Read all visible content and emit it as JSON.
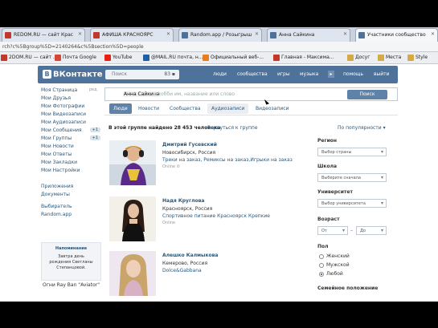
{
  "browser": {
    "tabs": [
      {
        "label": "REDOM.RU — сайт Крас",
        "active": false,
        "favicon": "#c0392b"
      },
      {
        "label": "АФИША КРАСНОЯРС",
        "active": false,
        "favicon": "#c0392b"
      },
      {
        "label": "Random.app / Розыгрыш",
        "active": false,
        "favicon": "#4e729a"
      },
      {
        "label": "Анна Сайкина",
        "active": false,
        "favicon": "#4e729a"
      },
      {
        "label": "Участники сообщество",
        "active": true,
        "favicon": "#4e729a"
      }
    ],
    "address": "rch?c%5Bgroup%5D=2140264&c%5Bsection%5D=people",
    "bookmarks": [
      {
        "label": "2DOM.RU — сайт ...",
        "icon": "#c0392b"
      },
      {
        "label": "Почта Google",
        "icon": "#d44638"
      },
      {
        "label": "YouTube",
        "icon": "#e62117"
      },
      {
        "label": "@MAIL.RU почта, н...",
        "icon": "#1e5fa8"
      },
      {
        "label": "Официальный веб-...",
        "icon": "#e67e22"
      },
      {
        "label": "Главная - Максима...",
        "icon": "#c0392b"
      },
      {
        "label": "Досуг",
        "icon": "#d4a94a"
      },
      {
        "label": "Места",
        "icon": "#d4a94a"
      },
      {
        "label": "Style",
        "icon": "#d4a94a"
      }
    ]
  },
  "vk": {
    "logo": "ВКонтакте",
    "header_search": {
      "placeholder": "Поиск",
      "count": "83 ▪"
    },
    "nav": [
      "люди",
      "сообщества",
      "игры",
      "музыка",
      "помощь",
      "выйти"
    ],
    "left_menu": [
      {
        "label": "Моя Страница",
        "badge": "ред."
      },
      {
        "label": "Мои Друзья",
        "badge": ""
      },
      {
        "label": "Мои Фотографии",
        "badge": ""
      },
      {
        "label": "Мои Видеозаписи",
        "badge": ""
      },
      {
        "label": "Мои Аудиозаписи",
        "badge": ""
      },
      {
        "label": "Мои Сообщения",
        "badge": "+1"
      },
      {
        "label": "Мои Группы",
        "badge": "+1"
      },
      {
        "label": "Мои Новости",
        "badge": ""
      },
      {
        "label": "Мои Ответы",
        "badge": ""
      },
      {
        "label": "Мои Закладки",
        "badge": ""
      },
      {
        "label": "Мои Настройки",
        "badge": ""
      }
    ],
    "left_menu_extra": [
      "Приложения",
      "Документы",
      "Выбиратель",
      "Random.app"
    ],
    "side_block": {
      "title": "Напоминание",
      "text": "Завтра день рождения Светланы Степанцовой."
    },
    "side_block2": {
      "text": "Огни Ray Ban \"Aviator\""
    },
    "search": {
      "typed": "Анна Сайкина",
      "hint": "ь хобби им, название или слово",
      "button": "Поиск"
    },
    "tabs": [
      {
        "label": "Люди",
        "state": "active"
      },
      {
        "label": "Новости",
        "state": "plain"
      },
      {
        "label": "Сообщества",
        "state": "plain"
      },
      {
        "label": "Аудиозаписи",
        "state": "gray"
      },
      {
        "label": "Видеозаписи",
        "state": "plain"
      }
    ],
    "result_header": "В этой группе найдено 28 453 человека",
    "result_link": "Вернуться к группе",
    "sort": "По популярности ▾",
    "people": [
      {
        "name": "Дмитрий Гусевский",
        "city": "Новосибирск, Россия",
        "status": "Треки на заказ, Ремиксы на заказ,Игрыки на заказ",
        "online": "Online ✆"
      },
      {
        "name": "Надя Круглова",
        "city": "Красноярск, Россия",
        "status": "Спортивное питание Красноярск Крепкие",
        "online": "Online"
      },
      {
        "name": "Алешко Калмыкова",
        "city": "Кемерово, Россия",
        "status": "Dolce&Gabbana",
        "online": ""
      }
    ],
    "filters": {
      "region_label": "Регион",
      "country": "Выбор страны",
      "school_label": "Школа",
      "school": "Выберите сначала",
      "university_label": "Университет",
      "university": "Выбор университета",
      "age_label": "Возраст",
      "age_from": "От",
      "age_to": "До",
      "dash": "–",
      "sex_label": "Пол",
      "sex_options": [
        "Женский",
        "Мужской",
        "Любой"
      ],
      "sex_selected_index": 2,
      "marital_label": "Семейное положение"
    }
  }
}
